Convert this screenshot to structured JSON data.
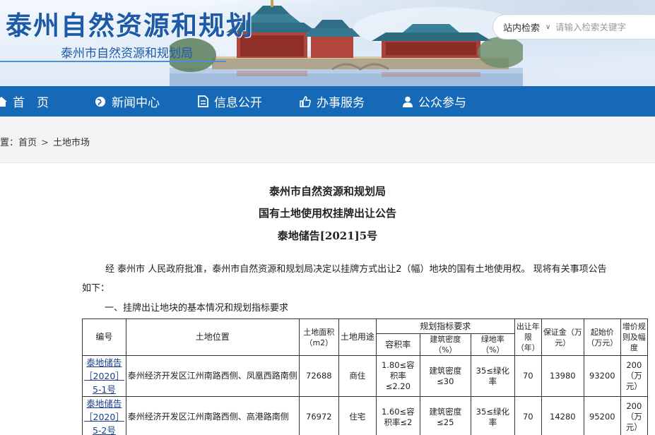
{
  "header": {
    "site_title": "泰州自然资源和规划",
    "site_subtitle": "泰州市自然资源和规划局",
    "search": {
      "scope": "站内检索",
      "placeholder": "请输入检索关键字"
    }
  },
  "nav": {
    "items": [
      {
        "label": "首　页",
        "icon": "home-icon"
      },
      {
        "label": "新闻中心",
        "icon": "globe-icon"
      },
      {
        "label": "信息公开",
        "icon": "document-icon"
      },
      {
        "label": "办事服务",
        "icon": "thumbs-up-icon"
      },
      {
        "label": "公众参与",
        "icon": "user-icon"
      }
    ]
  },
  "breadcrumb": {
    "prefix": "置：",
    "home": "首页",
    "sep": ">",
    "current": "土地市场"
  },
  "article": {
    "heading1": "泰州市自然资源和规划局",
    "heading2": "国有土地使用权挂牌出让公告",
    "heading3": "泰地储告[2021]5号",
    "intro_line1": "经 泰州市 人民政府批准，泰州市自然资源和规划局决定以挂牌方式出让2（幅）地块的国有土地使用权。 现将有关事项公告",
    "intro_line2": "如下：",
    "section1": "一、挂牌出让地块的基本情况和规划指标要求"
  },
  "table": {
    "headers": {
      "code": "编号",
      "location": "土地位置",
      "area": "土地面积（m2）",
      "use": "土地用途",
      "planning": "规划指标要求",
      "far": "容积率",
      "density": "建筑密度（%）",
      "green": "绿地率（%）",
      "term": "出让年限（年）",
      "deposit": "保证金（万元）",
      "start_price": "起始价（万元）",
      "increment": "增价规则及幅度"
    },
    "rows": [
      {
        "code": "泰地储告［2020］5-1号",
        "location": "泰州经济开发区江州南路西侧、凤凰西路南侧",
        "area": "72688",
        "use": "商住",
        "far": "1.80≤容积率≤2.20",
        "density": "建筑密度≤30",
        "green": "35≤绿化率",
        "term": "70",
        "deposit": "13980",
        "start_price": "93200",
        "increment": "200（万元）"
      },
      {
        "code": "泰地储告［2020］5-2号",
        "location": "泰州经济开发区江州南路西侧、高港路南侧",
        "area": "76972",
        "use": "住宅",
        "far": "1.60≤容积率≤2",
        "density": "建筑密度≤25",
        "green": "35≤绿化率",
        "term": "70",
        "deposit": "14280",
        "start_price": "95200",
        "increment": "200（万元）"
      }
    ]
  },
  "colors": {
    "brand_blue": "#1669b6",
    "title_blue": "#1d5ba8",
    "link_blue": "#1a3f8c"
  }
}
